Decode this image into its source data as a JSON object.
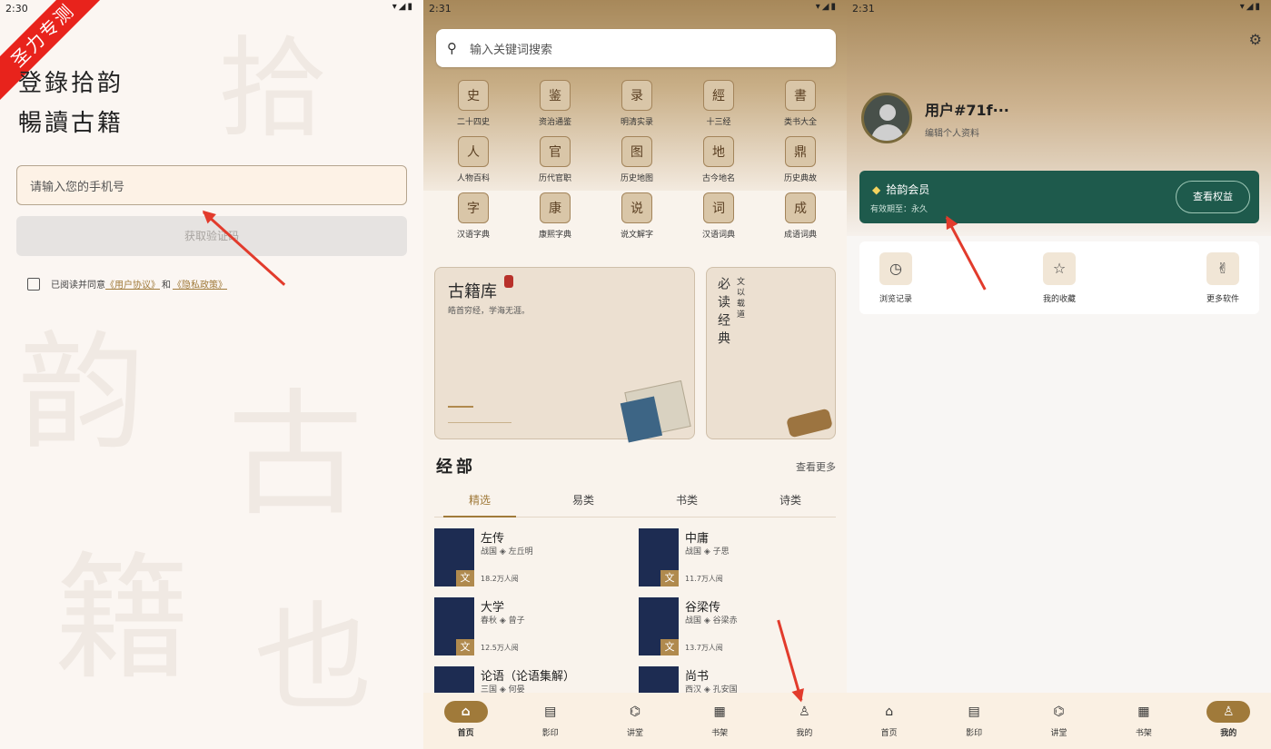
{
  "watermark": "圣力专测",
  "screen1": {
    "time": "2:30",
    "title_line1": "登錄拾韵",
    "title_line2": "暢讀古籍",
    "phone_placeholder": "请输入您的手机号",
    "code_button": "获取验证码",
    "agree_text": "已阅读并同意",
    "agree_link1": "《用户协议》",
    "agree_and": "和",
    "agree_link2": "《隐私政策》"
  },
  "screen2": {
    "time": "2:31",
    "search_placeholder": "输入关键词搜索",
    "categories": [
      {
        "label": "二十四史",
        "icon": "palace-icon",
        "glyph": "史"
      },
      {
        "label": "资治通鉴",
        "icon": "brush-icon",
        "glyph": "鉴"
      },
      {
        "label": "明清实录",
        "icon": "frame-icon",
        "glyph": "录"
      },
      {
        "label": "十三经",
        "icon": "scroll-icon",
        "glyph": "經"
      },
      {
        "label": "类书大全",
        "icon": "book-open-icon",
        "glyph": "書"
      },
      {
        "label": "人物百科",
        "icon": "person-icon",
        "glyph": "人"
      },
      {
        "label": "历代官职",
        "icon": "seal-icon",
        "glyph": "官"
      },
      {
        "label": "历史地图",
        "icon": "map-icon",
        "glyph": "图"
      },
      {
        "label": "古今地名",
        "icon": "landscape-icon",
        "glyph": "地"
      },
      {
        "label": "历史典故",
        "icon": "cauldron-icon",
        "glyph": "鼎"
      },
      {
        "label": "汉语字典",
        "icon": "dictionary-icon",
        "glyph": "字"
      },
      {
        "label": "康熙字典",
        "icon": "books-icon",
        "glyph": "康"
      },
      {
        "label": "说文解字",
        "icon": "medallion-icon",
        "glyph": "说"
      },
      {
        "label": "汉语词典",
        "icon": "fan-icon",
        "glyph": "词"
      },
      {
        "label": "成语词典",
        "icon": "lantern-icon",
        "glyph": "成"
      }
    ],
    "card_big": {
      "title": "古籍库",
      "subtitle": "皓首穷经，学海无涯。"
    },
    "card_small": {
      "main": "必读经典",
      "side": "文以载道"
    },
    "section_title": "经部",
    "more_label": "查看更多",
    "tabs": [
      "精选",
      "易类",
      "书类",
      "诗类"
    ],
    "books": [
      {
        "title": "左传",
        "author": "战国 ◈ 左丘明",
        "reads": "18.2万人阅"
      },
      {
        "title": "中庸",
        "author": "战国 ◈ 子思",
        "reads": "11.7万人阅"
      },
      {
        "title": "大学",
        "author": "春秋 ◈ 曾子",
        "reads": "12.5万人阅"
      },
      {
        "title": "谷梁传",
        "author": "战国 ◈ 谷梁赤",
        "reads": "13.7万人阅"
      },
      {
        "title": "论语（论语集解）",
        "author": "三国 ◈ 何晏",
        "reads": ""
      },
      {
        "title": "尚书",
        "author": "西汉 ◈ 孔安国",
        "reads": ""
      }
    ],
    "cover_tag": "文",
    "nav": [
      "首页",
      "影印",
      "讲堂",
      "书架",
      "我的"
    ]
  },
  "screen3": {
    "time": "2:31",
    "username": "用户#71f···",
    "edit_profile": "编辑个人资料",
    "vip_title": "拾韵会员",
    "vip_validity": "有效期至：永久",
    "vip_button": "查看权益",
    "quick": [
      "浏览记录",
      "我的收藏",
      "更多软件"
    ],
    "nav": [
      "首页",
      "影印",
      "讲堂",
      "书架",
      "我的"
    ]
  }
}
